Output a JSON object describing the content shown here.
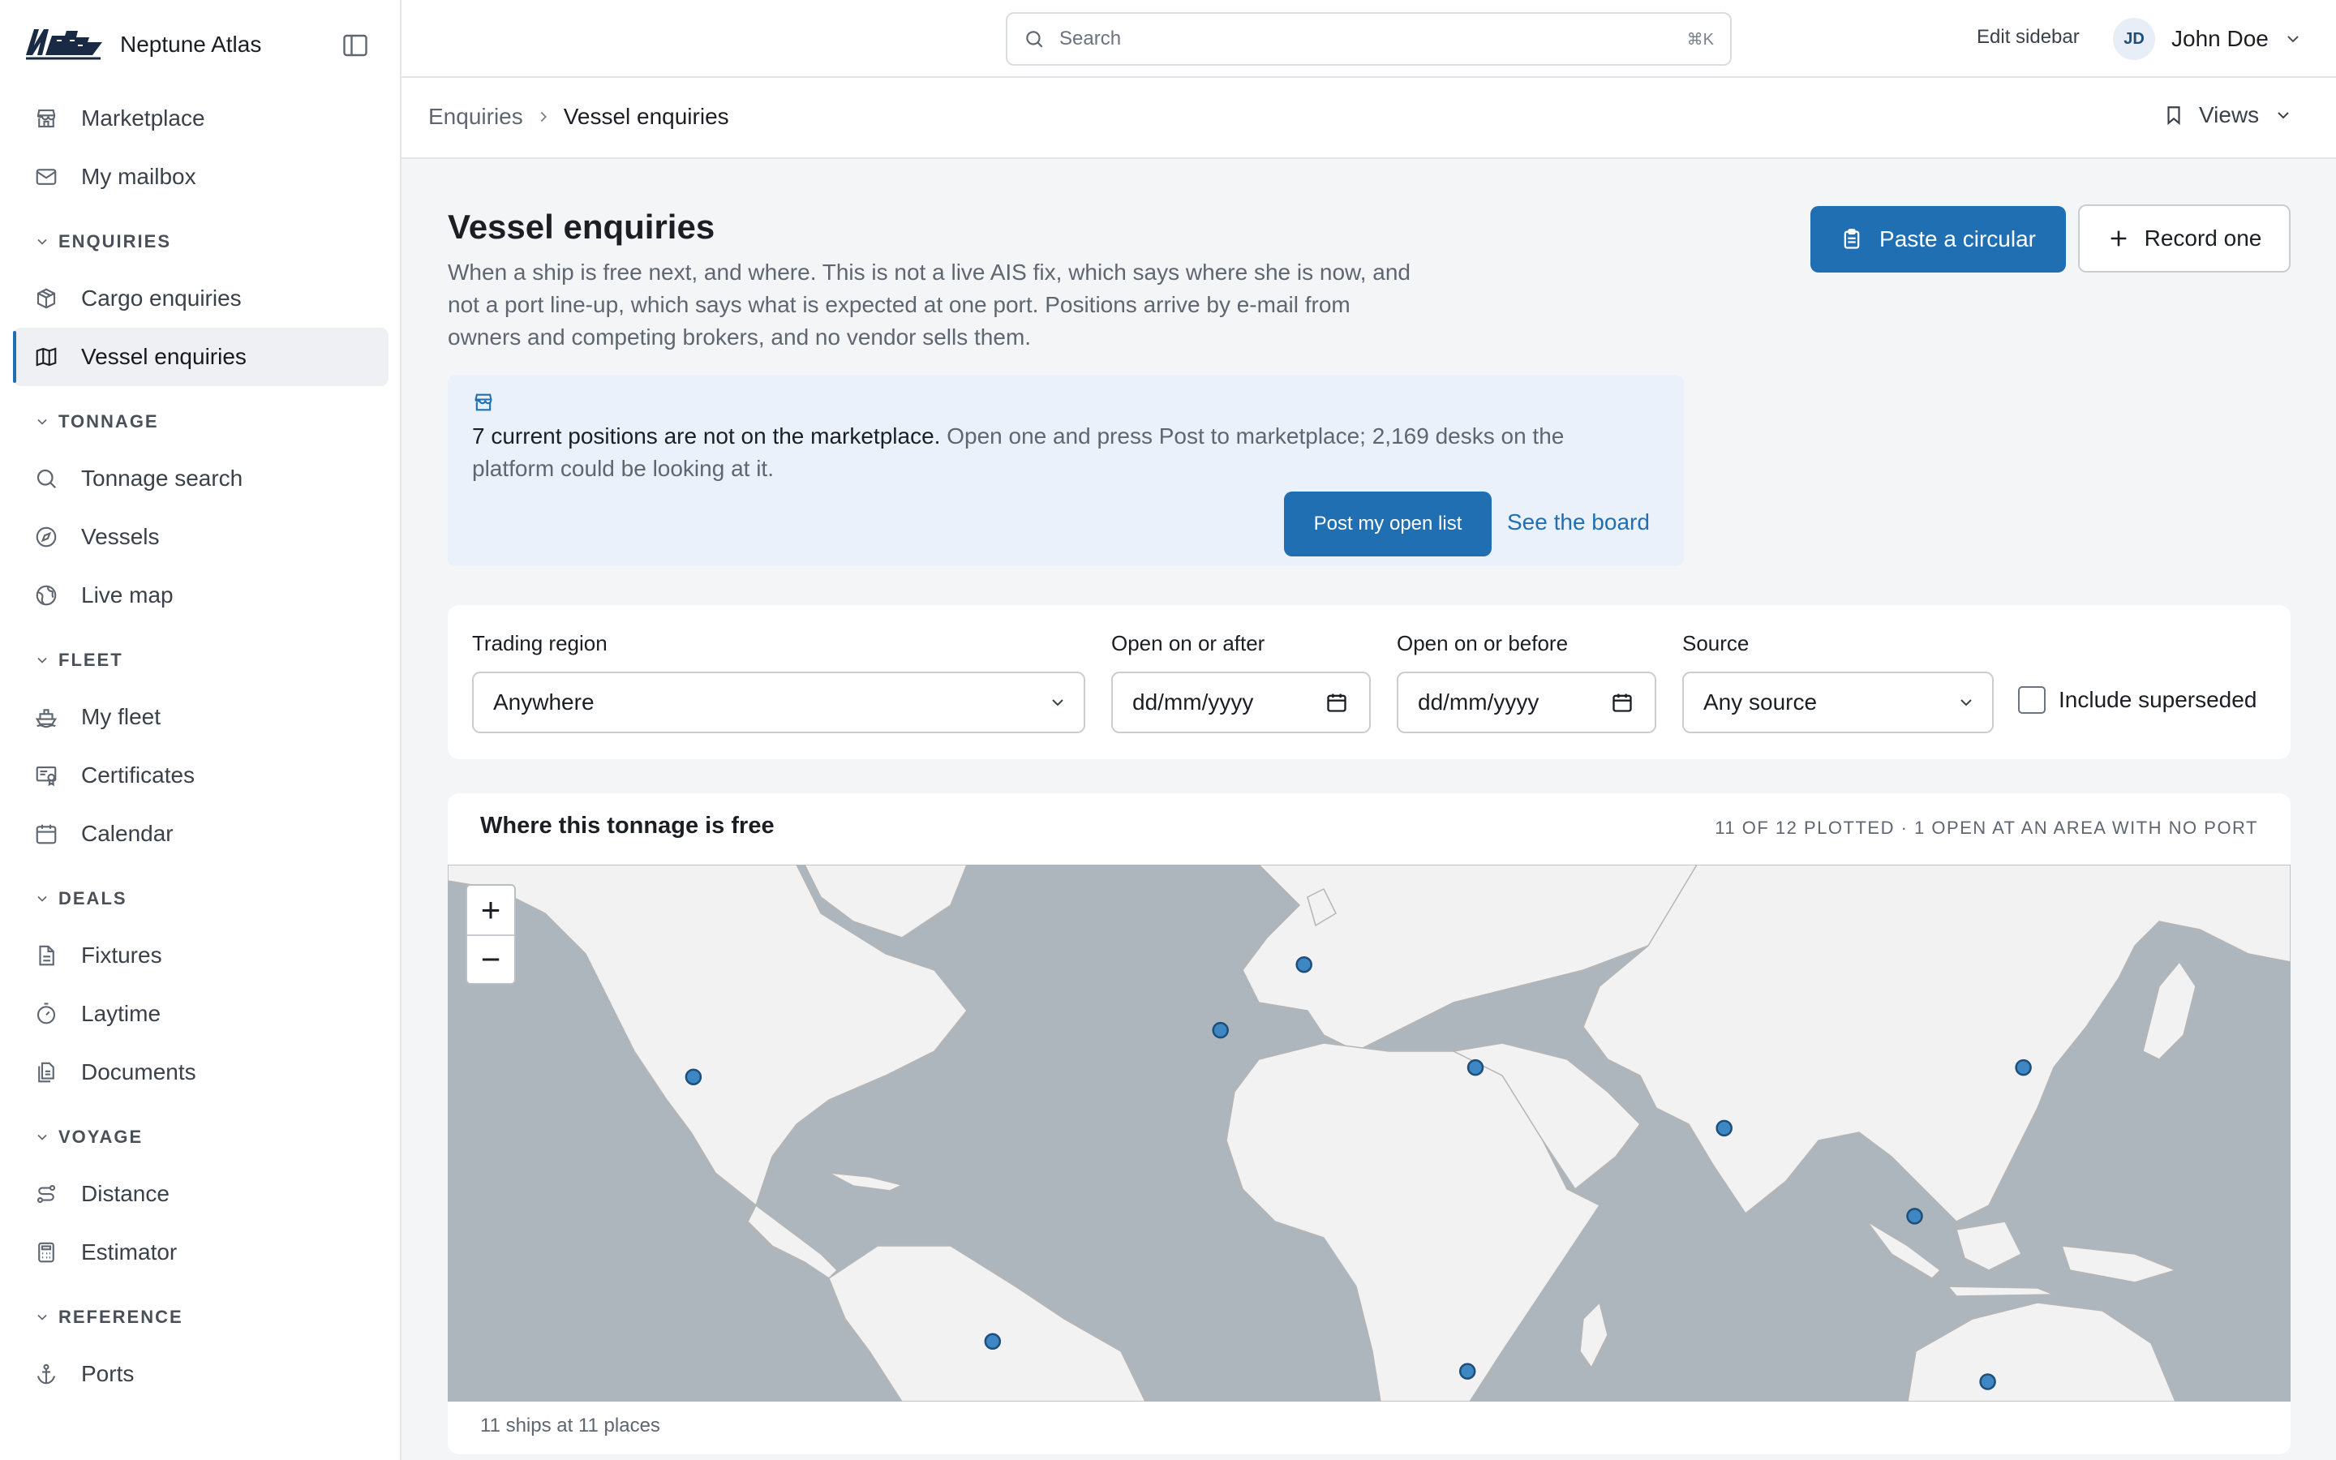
{
  "app": {
    "name": "Neptune Atlas"
  },
  "sidebar": {
    "top_items": [
      {
        "label": "Marketplace",
        "icon": "store-icon"
      },
      {
        "label": "My mailbox",
        "icon": "mail-icon"
      }
    ],
    "sections": [
      {
        "title": "ENQUIRIES",
        "items": [
          {
            "label": "Cargo enquiries",
            "icon": "box-icon"
          },
          {
            "label": "Vessel enquiries",
            "icon": "map-icon",
            "active": true
          }
        ]
      },
      {
        "title": "TONNAGE",
        "items": [
          {
            "label": "Tonnage search",
            "icon": "search-icon"
          },
          {
            "label": "Vessels",
            "icon": "compass-icon"
          },
          {
            "label": "Live map",
            "icon": "globe-icon"
          }
        ]
      },
      {
        "title": "FLEET",
        "items": [
          {
            "label": "My fleet",
            "icon": "ship-icon"
          },
          {
            "label": "Certificates",
            "icon": "certificate-icon"
          },
          {
            "label": "Calendar",
            "icon": "calendar-icon"
          }
        ]
      },
      {
        "title": "DEALS",
        "items": [
          {
            "label": "Fixtures",
            "icon": "document-icon"
          },
          {
            "label": "Laytime",
            "icon": "stopwatch-icon"
          },
          {
            "label": "Documents",
            "icon": "files-icon"
          }
        ]
      },
      {
        "title": "VOYAGE",
        "items": [
          {
            "label": "Distance",
            "icon": "route-icon"
          },
          {
            "label": "Estimator",
            "icon": "calculator-icon"
          }
        ]
      },
      {
        "title": "REFERENCE",
        "items": [
          {
            "label": "Ports",
            "icon": "anchor-icon"
          }
        ]
      }
    ]
  },
  "topbar": {
    "search_placeholder": "Search",
    "search_shortcut": "⌘K",
    "edit_sidebar": "Edit sidebar",
    "user": {
      "initials": "JD",
      "name": "John Doe"
    }
  },
  "breadcrumb": {
    "parent": "Enquiries",
    "current": "Vessel enquiries",
    "views": "Views"
  },
  "page": {
    "title": "Vessel enquiries",
    "description": "When a ship is free next, and where. This is not a live AIS fix, which says where she is now, and not a port line-up, which says what is expected at one port. Positions arrive by e-mail from owners and competing brokers, and no vendor sells them.",
    "primary_action": "Paste a circular",
    "secondary_action": "Record one"
  },
  "callout": {
    "strong": "7 current positions are not on the marketplace.",
    "text": " Open one and press Post to marketplace; 2,169 desks on the platform could be looking at it.",
    "button": "Post my open list",
    "link": "See the board"
  },
  "filters": {
    "region_label": "Trading region",
    "region_value": "Anywhere",
    "after_label": "Open on or after",
    "after_value": "dd/mm/yyyy",
    "before_label": "Open on or before",
    "before_value": "dd/mm/yyyy",
    "source_label": "Source",
    "source_value": "Any source",
    "superseded_label": "Include superseded",
    "superseded_checked": false
  },
  "map": {
    "title": "Where this tonnage is free",
    "meta": "11 OF 12 PLOTTED · 1 OPEN AT AN AREA WITH NO PORT",
    "footer": "11 ships at 11 places",
    "zoom_in": "+",
    "zoom_out": "−",
    "colors": {
      "sea": "#aeb6bd",
      "land": "#f2f2f2",
      "border": "#b5b5b5",
      "marker": "#3d87c4",
      "marker_stroke": "#1f4e79"
    },
    "positions": [
      {
        "lon": -95.0,
        "lat": 29.3
      },
      {
        "lon": -46.3,
        "lat": -23.9
      },
      {
        "lon": -9.2,
        "lat": 38.7
      },
      {
        "lon": 4.4,
        "lat": 51.9
      },
      {
        "lon": 32.3,
        "lat": 31.2
      },
      {
        "lon": 72.8,
        "lat": 19.0
      },
      {
        "lon": 103.8,
        "lat": 1.3
      },
      {
        "lon": 121.5,
        "lat": 31.2
      },
      {
        "lon": 115.7,
        "lat": -32.0
      },
      {
        "lon": 31.0,
        "lat": -29.9
      }
    ]
  },
  "colors": {
    "accent": "#1f6fb2",
    "callout_bg": "#eaf1fb"
  }
}
